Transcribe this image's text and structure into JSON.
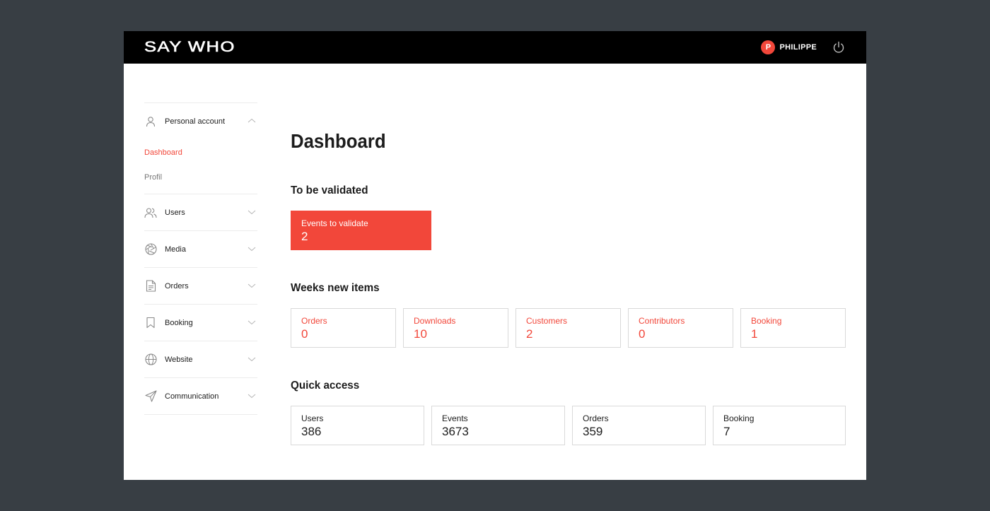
{
  "header": {
    "logo": "SAY WHO",
    "user_initial": "P",
    "user_name": "PHILIPPE"
  },
  "sidebar": {
    "personal_account": {
      "label": "Personal account",
      "icon": "user-icon",
      "items": [
        {
          "label": "Dashboard",
          "active": true
        },
        {
          "label": "Profil",
          "active": false
        }
      ]
    },
    "sections": [
      {
        "label": "Users",
        "icon": "users-icon"
      },
      {
        "label": "Media",
        "icon": "aperture-icon"
      },
      {
        "label": "Orders",
        "icon": "document-icon"
      },
      {
        "label": "Booking",
        "icon": "bookmark-icon"
      },
      {
        "label": "Website",
        "icon": "globe-icon"
      },
      {
        "label": "Communication",
        "icon": "send-icon"
      }
    ]
  },
  "main": {
    "title": "Dashboard",
    "to_be_validated": {
      "title": "To be validated",
      "cards": [
        {
          "label": "Events to validate",
          "value": "2"
        }
      ]
    },
    "weeks_new_items": {
      "title": "Weeks new items",
      "cards": [
        {
          "label": "Orders",
          "value": "0"
        },
        {
          "label": "Downloads",
          "value": "10"
        },
        {
          "label": "Customers",
          "value": "2"
        },
        {
          "label": "Contributors",
          "value": "0"
        },
        {
          "label": "Booking",
          "value": "1"
        }
      ]
    },
    "quick_access": {
      "title": "Quick access",
      "cards": [
        {
          "label": "Users",
          "value": "386"
        },
        {
          "label": "Events",
          "value": "3673"
        },
        {
          "label": "Orders",
          "value": "359"
        },
        {
          "label": "Booking",
          "value": "7"
        }
      ]
    }
  },
  "colors": {
    "accent": "#f2473a",
    "background": "#383e44",
    "topbar": "#000000"
  }
}
